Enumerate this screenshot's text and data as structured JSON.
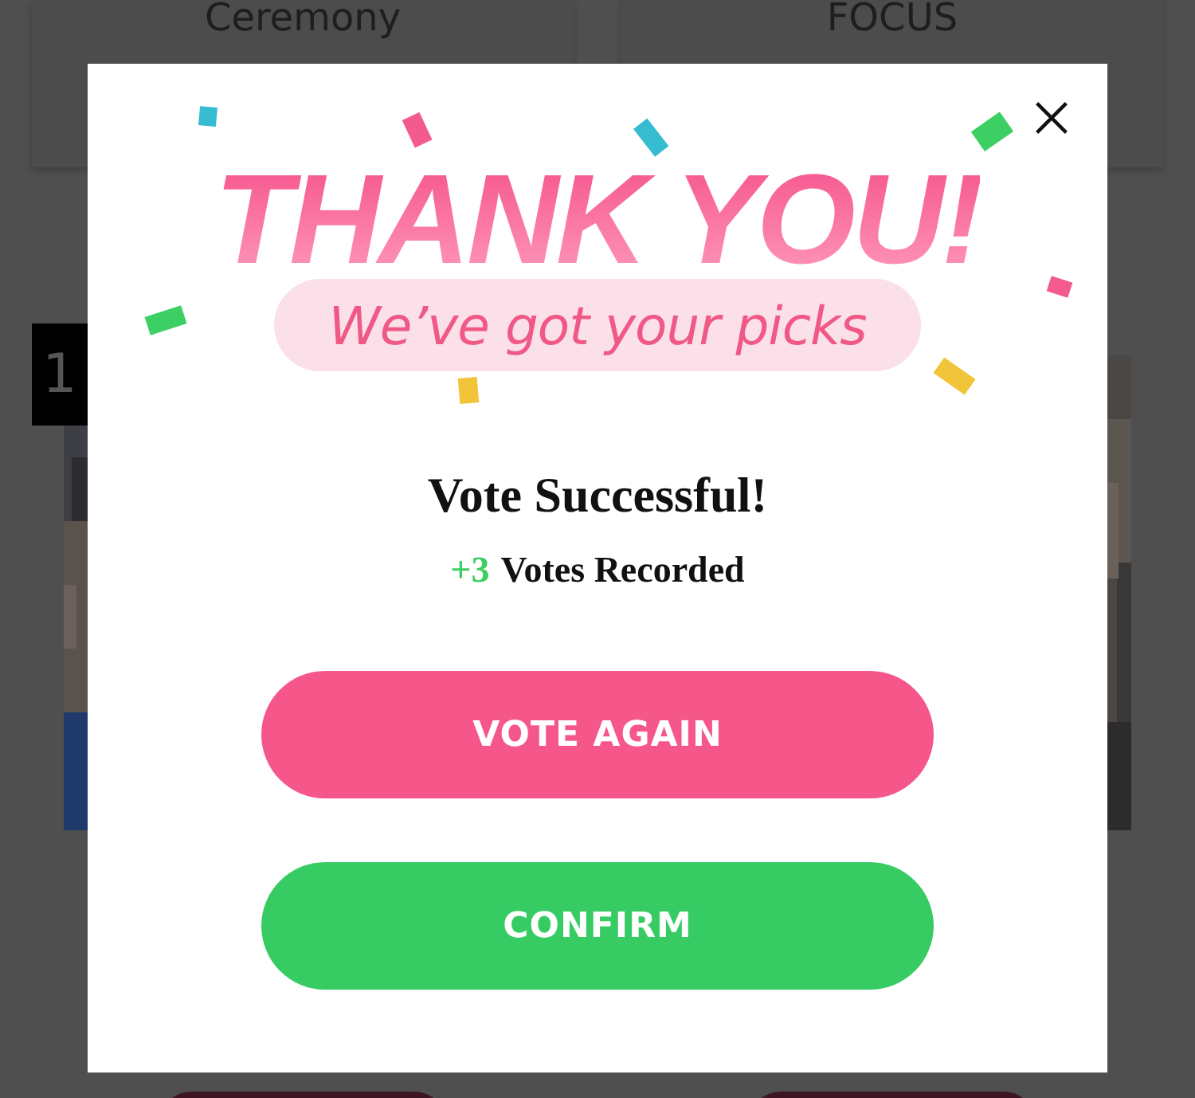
{
  "background": {
    "cards": [
      {
        "title": "Ceremony"
      },
      {
        "title": "FOCUS"
      }
    ],
    "rank": "1"
  },
  "dialog": {
    "headline": "THANK YOU!",
    "subheadline": "We’ve got your picks",
    "title": "Vote Successful!",
    "votes_count": "+3",
    "votes_label": "Votes Recorded",
    "buttons": [
      {
        "label": "VOTE AGAIN",
        "kind": "primary"
      },
      {
        "label": "CONFIRM",
        "kind": "confirm"
      }
    ]
  }
}
